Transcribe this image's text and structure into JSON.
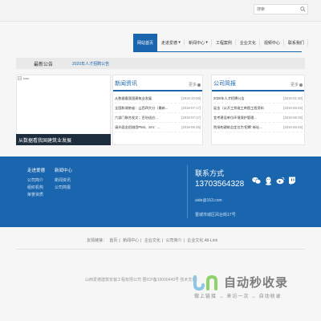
{
  "header": {
    "search_placeholder": "搜索",
    "nav": [
      {
        "label": "网站首页",
        "active": true
      },
      {
        "label": "走进爱德"
      },
      {
        "label": "新闻中心"
      },
      {
        "label": "工程案例"
      },
      {
        "label": "企业文化"
      },
      {
        "label": "视频中心"
      },
      {
        "label": "联系我们"
      }
    ]
  },
  "notice": {
    "title": "最新公告",
    "text": "2020年人才招聘公告"
  },
  "picture": {
    "alt": "icon",
    "caption": "从数据看我国建筑业发展"
  },
  "news_left": {
    "title": "新闻资讯",
    "more": "更多",
    "items": [
      {
        "title": "从数据看我国建筑业发展",
        "date": "[2019-10-08]"
      },
      {
        "title": "全国和湖南省：山西四大分（最新...",
        "date": "[2019-07-17]"
      },
      {
        "title": "六部门联合发文：百份适应...",
        "date": "[2019-07-17]"
      },
      {
        "title": "请外面金招借用PM4，SAI：...",
        "date": "[2019-06-25]"
      }
    ]
  },
  "news_right": {
    "title": "公司简报",
    "more": "更多",
    "items": [
      {
        "title": "2020年人才招聘公告",
        "date": "[2019-01-30]"
      },
      {
        "title": "延金（从开工到竣工审图工程资料",
        "date": "[2019-06-25]"
      },
      {
        "title": "宜考建设单位环境保护管理...",
        "date": "[2019-06-25]"
      },
      {
        "title": "院场构建筑总定位为'招聘' 新址...",
        "date": "[2019-06-25]"
      }
    ]
  },
  "footer": {
    "col1": {
      "title": "走进爱德",
      "links": [
        "公司简介",
        "组织机构",
        "荣誉资质"
      ]
    },
    "col2": {
      "title": "新闻中心",
      "links": [
        "新闻资讯",
        "公司简报"
      ]
    },
    "contact_title": "联系方式",
    "phone": "13703564328",
    "email": "aide@163.com",
    "address": "晋城市城区凤台街17号"
  },
  "links": {
    "label": "友情链接：",
    "items": [
      "首页",
      "新闻中心",
      "企业文化",
      "公司简介",
      "企业文化 All-Link"
    ]
  },
  "copyright": "山西爱德建筑安装工程有限公司    晋ICP备19000449号    技术支持：",
  "watermark": {
    "name": "自动秒收录",
    "sub": "做上链接 → 来访一次 → 自动收录"
  },
  "colors": {
    "primary": "#1a66ae",
    "caption_bar": "#1e2d3d"
  }
}
